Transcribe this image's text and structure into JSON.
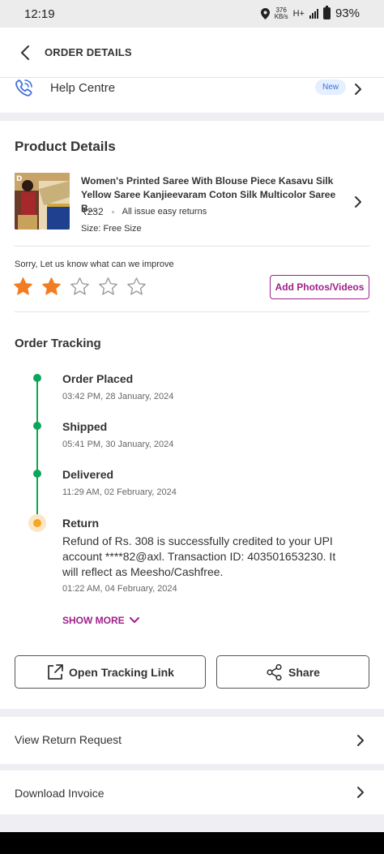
{
  "status_bar": {
    "time": "12:19",
    "net_speed_value": "376",
    "net_speed_unit": "KB/s",
    "network": "H+",
    "battery": "93%"
  },
  "header": {
    "title": "ORDER DETAILS",
    "back_icon": "chevron-left-icon"
  },
  "help": {
    "label": "Help Centre",
    "badge": "New",
    "icon": "phone-icon"
  },
  "product_details": {
    "title": "Product Details",
    "name": "Women's Printed Saree With Blouse Piece Kasavu Silk Yellow Saree Kanjieevaram Coton Silk Multicolor Saree B...",
    "price": "₹232",
    "returns": "All issue easy returns",
    "size": "Size: Free Size",
    "rating_prompt": "Sorry, Let us know what can we improve",
    "rating": 2,
    "rating_max": 5,
    "add_photos": "Add Photos/Videos"
  },
  "order_tracking": {
    "title": "Order Tracking",
    "steps": [
      {
        "title": "Order Placed",
        "time": "03:42 PM, 28 January, 2024"
      },
      {
        "title": "Shipped",
        "time": "05:41 PM, 30 January, 2024"
      },
      {
        "title": "Delivered",
        "time": "11:29 AM, 02 February, 2024"
      },
      {
        "title": "Return",
        "description": "Refund of Rs. 308 is successfully credited to your UPI account ****82@axl. Transaction ID: 403501653230. It will reflect as Meesho/Cashfree.",
        "time": "01:22 AM, 04 February, 2024"
      }
    ],
    "show_more": "SHOW MORE"
  },
  "actions": {
    "open_tracking": "Open Tracking Link",
    "share": "Share"
  },
  "links": {
    "view_return": "View Return Request",
    "download_invoice": "Download Invoice"
  },
  "colors": {
    "accent": "#9f2089",
    "success": "#0ea55b",
    "star": "#f47c20",
    "return_dot": "#f5a623"
  }
}
